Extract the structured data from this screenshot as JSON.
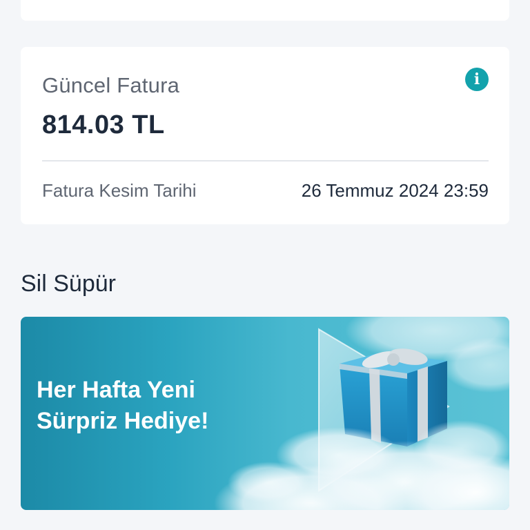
{
  "invoice": {
    "title": "Güncel Fatura",
    "amount": "814.03 TL",
    "info_icon": "info-icon",
    "date_label": "Fatura Kesim Tarihi",
    "date_value": "26 Temmuz 2024 23:59"
  },
  "section": {
    "title": "Sil Süpür"
  },
  "promo": {
    "line1": "Her Hafta Yeni",
    "line2": "Sürpriz Hediye!",
    "image_icon": "gift-box-icon"
  },
  "colors": {
    "accent": "#13a2ac",
    "banner_start": "#1c8aa7",
    "banner_end": "#5cc3d6",
    "text_dark": "#1e2a3b",
    "text_muted": "#5f6672"
  }
}
